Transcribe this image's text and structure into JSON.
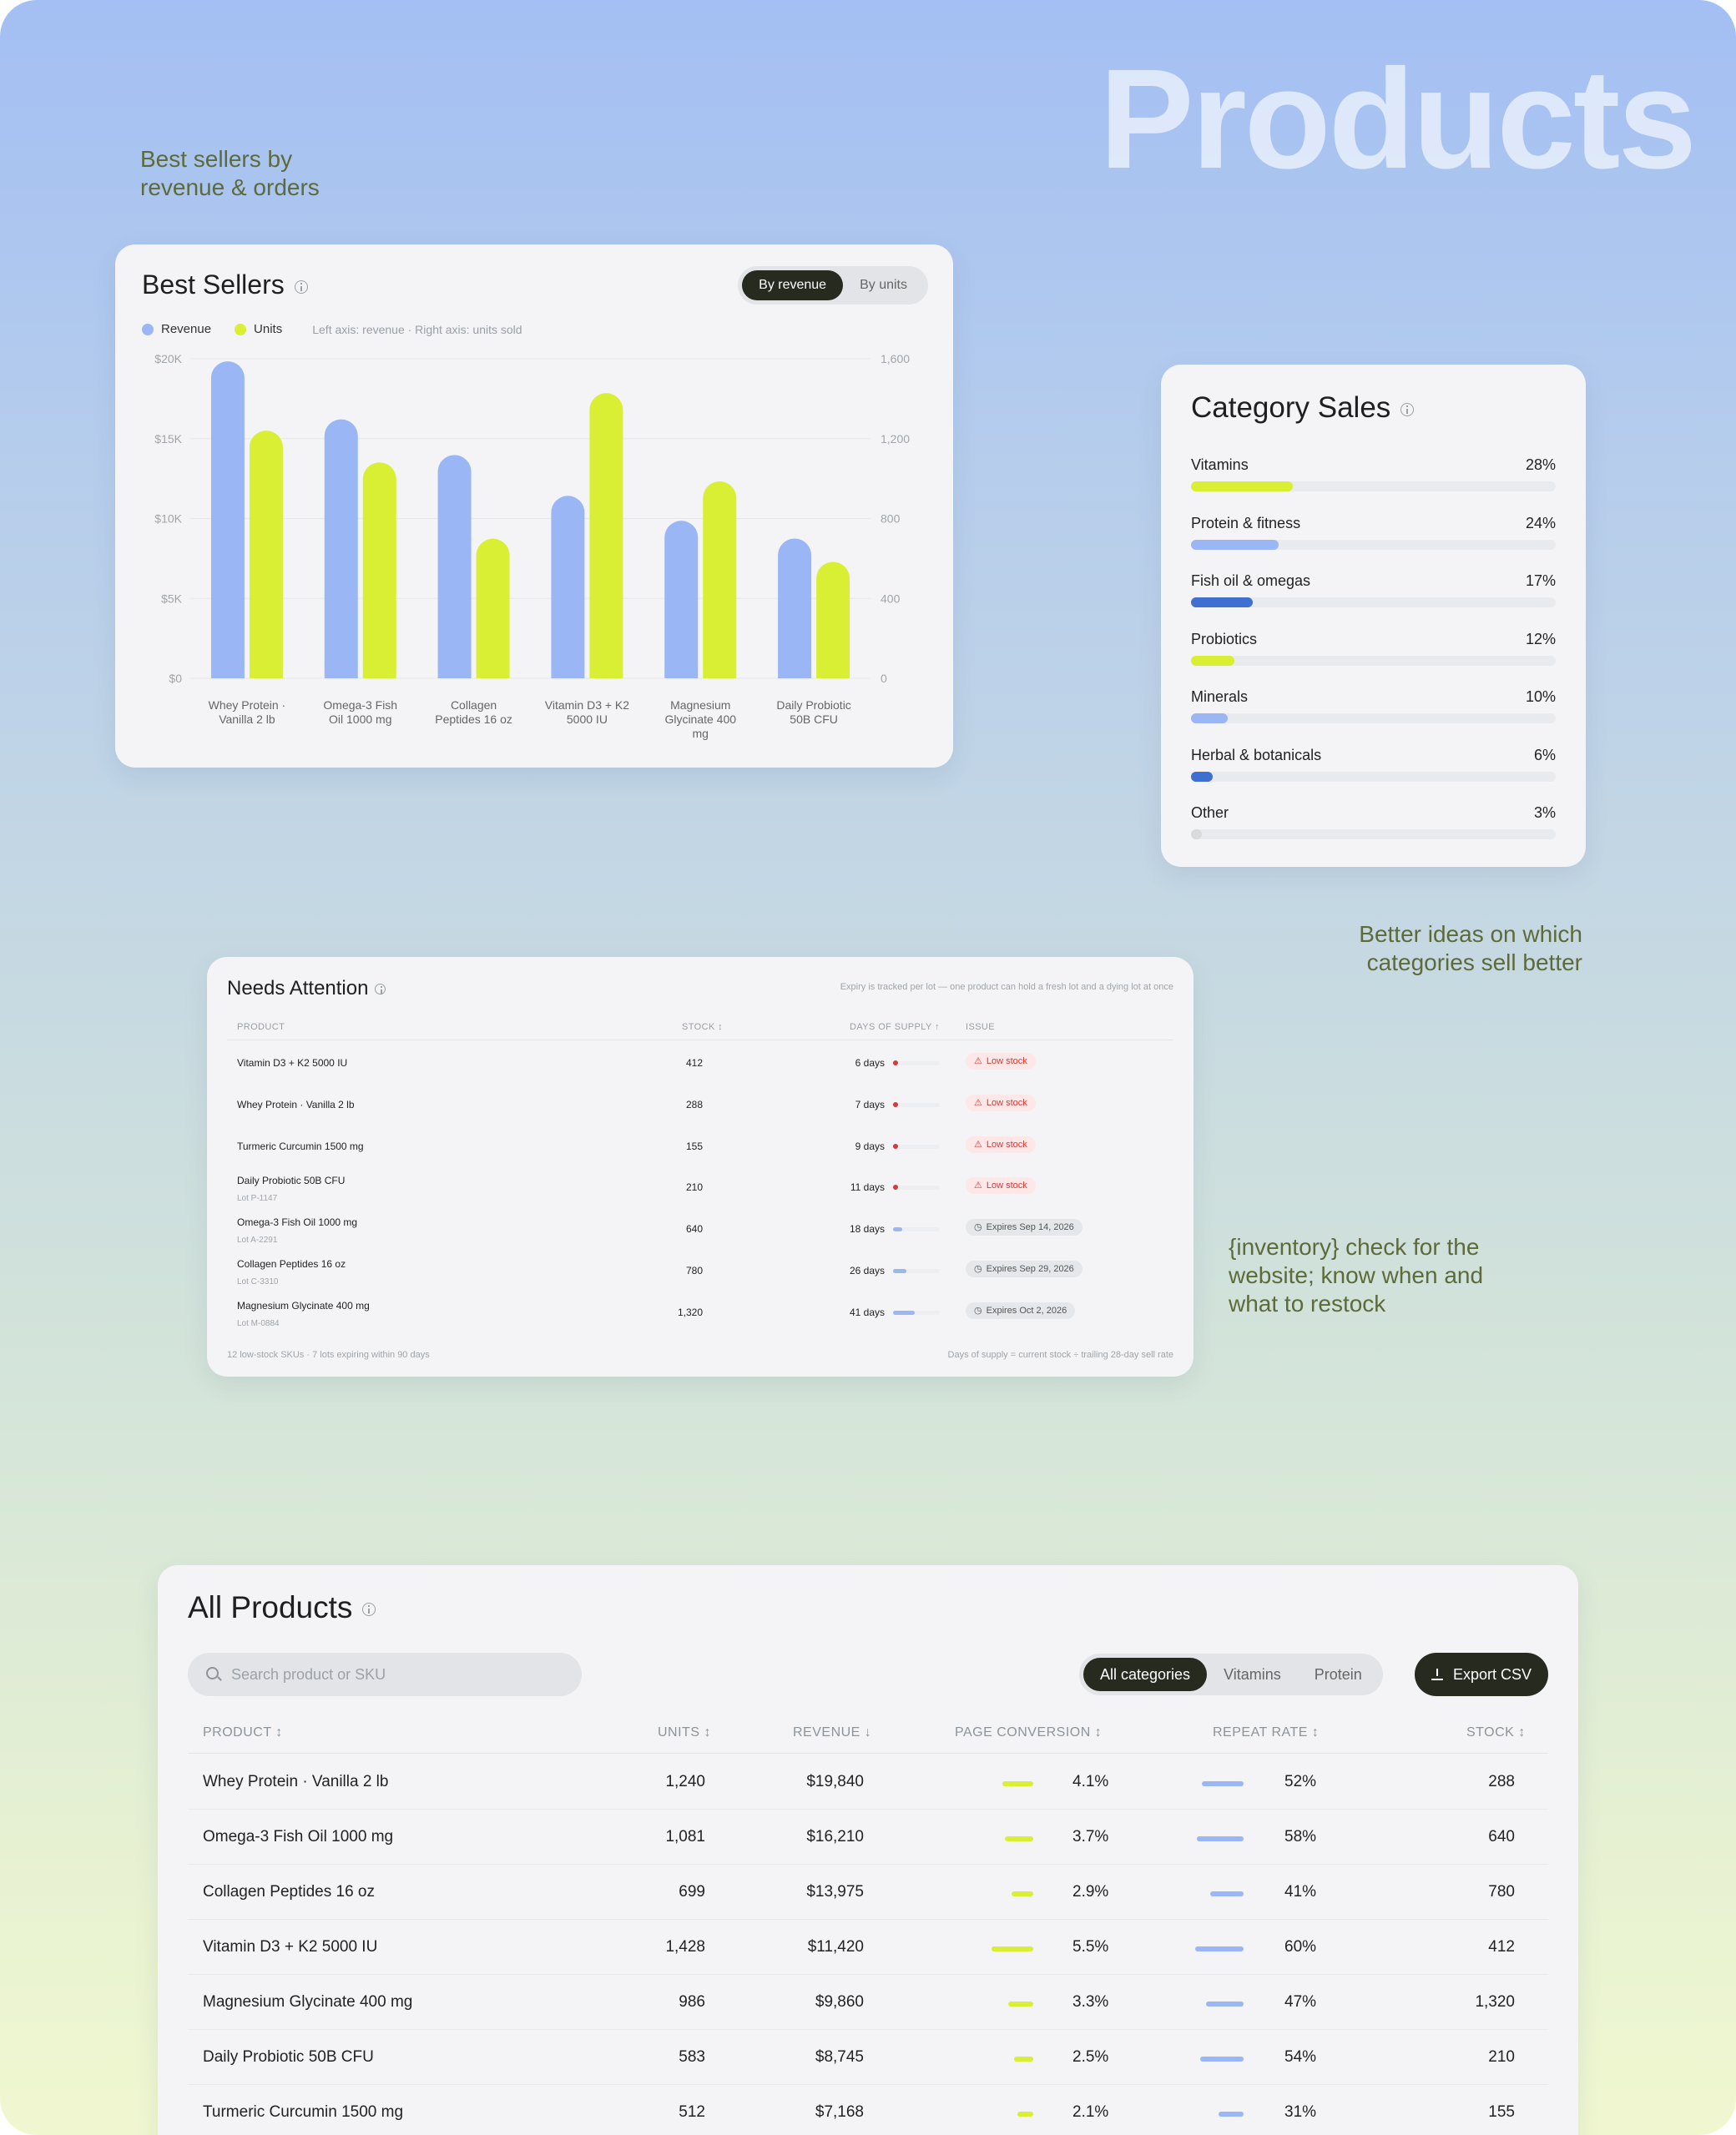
{
  "hero_title": "Products",
  "notes": {
    "best_sellers": "Best sellers by revenue & orders",
    "categories": "Better ideas on which categories sell better",
    "inventory": "{inventory} check for the website; know when and what to restock"
  },
  "colors": {
    "revenue": "#9ab6f5",
    "units": "#d8ef34",
    "dark_blue": "#3f6fd0",
    "low_red": "#d23b3b",
    "grey": "#d9dadd"
  },
  "best_sellers": {
    "title": "Best Sellers",
    "toggle": [
      "By revenue",
      "By units"
    ],
    "legend": [
      "Revenue",
      "Units"
    ],
    "axis_note": "Left axis: revenue · Right axis: units sold"
  },
  "chart_data": {
    "type": "bar",
    "title": "Best Sellers",
    "categories": [
      "Whey Protein · Vanilla 2 lb",
      "Omega-3 Fish Oil 1000 mg",
      "Collagen Peptides 16 oz",
      "Vitamin D3 + K2 5000 IU",
      "Magnesium Glycinate 400 mg",
      "Daily Probiotic 50B CFU"
    ],
    "series": [
      {
        "name": "Revenue",
        "axis": "left",
        "values": [
          19840,
          16210,
          13975,
          11420,
          9860,
          8745
        ]
      },
      {
        "name": "Units",
        "axis": "right",
        "values": [
          1240,
          1081,
          699,
          1428,
          986,
          583
        ]
      }
    ],
    "left_axis_ticks": [
      "$0",
      "$5K",
      "$10K",
      "$15K",
      "$20K"
    ],
    "right_axis_ticks": [
      "0",
      "400",
      "800",
      "1,200",
      "1,600"
    ],
    "ylim_left": [
      0,
      20000
    ],
    "ylim_right": [
      0,
      1600
    ],
    "legend": "top-left",
    "grid": true
  },
  "category_sales": {
    "title": "Category Sales",
    "items": [
      {
        "name": "Vitamins",
        "pct": "28%",
        "value": 28,
        "color": "#d8ef34"
      },
      {
        "name": "Protein & fitness",
        "pct": "24%",
        "value": 24,
        "color": "#9ab6f5"
      },
      {
        "name": "Fish oil & omegas",
        "pct": "17%",
        "value": 17,
        "color": "#3f6fd0"
      },
      {
        "name": "Probiotics",
        "pct": "12%",
        "value": 12,
        "color": "#d8ef34"
      },
      {
        "name": "Minerals",
        "pct": "10%",
        "value": 10,
        "color": "#9ab6f5"
      },
      {
        "name": "Herbal & botanicals",
        "pct": "6%",
        "value": 6,
        "color": "#3f6fd0"
      },
      {
        "name": "Other",
        "pct": "3%",
        "value": 3,
        "color": "#d9dadd"
      }
    ]
  },
  "needs_attention": {
    "title": "Needs Attention",
    "note": "Expiry is tracked per lot — one product can hold a fresh lot and a dying lot at once",
    "columns": [
      "PRODUCT",
      "STOCK ↕",
      "DAYS OF SUPPLY ↑",
      "ISSUE"
    ],
    "rows": [
      {
        "product": "Vitamin D3 + K2 5000 IU",
        "lot": "",
        "stock": "412",
        "days": "6 days",
        "days_value": 6,
        "issue": "Low stock",
        "type": "low"
      },
      {
        "product": "Whey Protein · Vanilla 2 lb",
        "lot": "",
        "stock": "288",
        "days": "7 days",
        "days_value": 7,
        "issue": "Low stock",
        "type": "low"
      },
      {
        "product": "Turmeric Curcumin 1500 mg",
        "lot": "",
        "stock": "155",
        "days": "9 days",
        "days_value": 9,
        "issue": "Low stock",
        "type": "low"
      },
      {
        "product": "Daily Probiotic 50B CFU",
        "lot": "Lot P-1147",
        "stock": "210",
        "days": "11 days",
        "days_value": 11,
        "issue": "Low stock",
        "type": "low"
      },
      {
        "product": "Omega-3 Fish Oil 1000 mg",
        "lot": "Lot A-2291",
        "stock": "640",
        "days": "18 days",
        "days_value": 18,
        "issue": "Expires Sep 14, 2026",
        "type": "exp"
      },
      {
        "product": "Collagen Peptides 16 oz",
        "lot": "Lot C-3310",
        "stock": "780",
        "days": "26 days",
        "days_value": 26,
        "issue": "Expires Sep 29, 2026",
        "type": "exp"
      },
      {
        "product": "Magnesium Glycinate 400 mg",
        "lot": "Lot M-0884",
        "stock": "1,320",
        "days": "41 days",
        "days_value": 41,
        "issue": "Expires Oct 2, 2026",
        "type": "exp"
      }
    ],
    "footer_left": "12 low-stock SKUs · 7 lots expiring within 90 days",
    "footer_right": "Days of supply = current stock ÷ trailing 28-day sell rate"
  },
  "all_products": {
    "title": "All Products",
    "search_placeholder": "Search product or SKU",
    "filters": [
      "All categories",
      "Vitamins",
      "Protein"
    ],
    "export_label": "Export CSV",
    "columns": [
      "PRODUCT ↕",
      "UNITS ↕",
      "REVENUE ↓",
      "PAGE CONVERSION ↕",
      "REPEAT RATE ↕",
      "STOCK ↕"
    ],
    "rows": [
      {
        "product": "Whey Protein · Vanilla 2 lb",
        "units": "1,240",
        "revenue": "$19,840",
        "conversion": "4.1%",
        "conv_value": 4.1,
        "repeat": "52%",
        "repeat_value": 52,
        "stock": "288"
      },
      {
        "product": "Omega-3 Fish Oil 1000 mg",
        "units": "1,081",
        "revenue": "$16,210",
        "conversion": "3.7%",
        "conv_value": 3.7,
        "repeat": "58%",
        "repeat_value": 58,
        "stock": "640"
      },
      {
        "product": "Collagen Peptides 16 oz",
        "units": "699",
        "revenue": "$13,975",
        "conversion": "2.9%",
        "conv_value": 2.9,
        "repeat": "41%",
        "repeat_value": 41,
        "stock": "780"
      },
      {
        "product": "Vitamin D3 + K2 5000 IU",
        "units": "1,428",
        "revenue": "$11,420",
        "conversion": "5.5%",
        "conv_value": 5.5,
        "repeat": "60%",
        "repeat_value": 60,
        "stock": "412"
      },
      {
        "product": "Magnesium Glycinate 400 mg",
        "units": "986",
        "revenue": "$9,860",
        "conversion": "3.3%",
        "conv_value": 3.3,
        "repeat": "47%",
        "repeat_value": 47,
        "stock": "1,320"
      },
      {
        "product": "Daily Probiotic 50B CFU",
        "units": "583",
        "revenue": "$8,745",
        "conversion": "2.5%",
        "conv_value": 2.5,
        "repeat": "54%",
        "repeat_value": 54,
        "stock": "210"
      },
      {
        "product": "Turmeric Curcumin 1500 mg",
        "units": "512",
        "revenue": "$7,168",
        "conversion": "2.1%",
        "conv_value": 2.1,
        "repeat": "31%",
        "repeat_value": 31,
        "stock": "155"
      }
    ]
  }
}
